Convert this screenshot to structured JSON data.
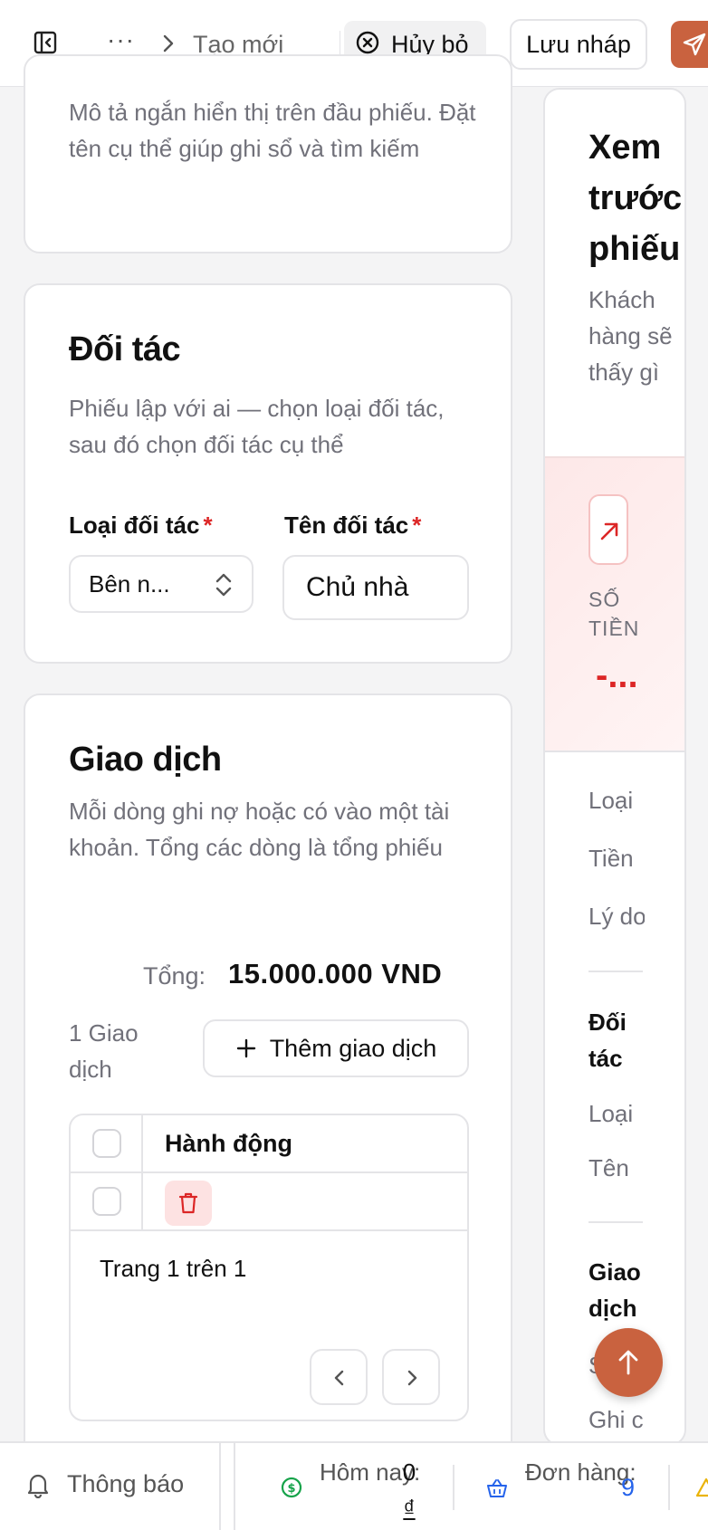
{
  "header": {
    "more_label": "···",
    "breadcrumb_current": "Tạo mới",
    "cancel_label": "Hủy bỏ",
    "save_draft_label": "Lưu nháp",
    "accent_color": "#c9623f"
  },
  "general": {
    "description": "Mô tả ngắn hiển thị trên đầu phiếu. Đặt tên cụ thể giúp ghi sổ và tìm kiếm"
  },
  "partner": {
    "title": "Đối tác",
    "description": "Phiếu lập với ai — chọn loại đối tác, sau đó chọn đối tác cụ thể",
    "type_label": "Loại đối tác",
    "type_value": "Bên n...",
    "name_label": "Tên đối tác",
    "name_value": "Chủ nhà",
    "required_mark": "*"
  },
  "transactions": {
    "title": "Giao dịch",
    "description": "Mỗi dòng ghi nợ hoặc có vào một tài khoản. Tổng các dòng là tổng phiếu",
    "total_label": "Tổng:",
    "total_value": "15.000.000 VND",
    "count_text": "1 Giao dịch",
    "add_button_label": "Thêm giao dịch",
    "table": {
      "columns": [
        "Hành động"
      ],
      "row_count": 1
    },
    "pagination_text": "Trang 1 trên 1"
  },
  "preview": {
    "title": "Xem trước phiếu",
    "subtitle": "Khách hàng sẽ thấy gì",
    "amount_label": "SỐ TIỀN",
    "amount_value": "-...",
    "rows": [
      "Loại",
      "Tiền",
      "Lý do"
    ],
    "partner_heading": "Đối tác",
    "partner_rows": [
      "Loại",
      "Tên"
    ],
    "transactions_heading": "Giao dịch",
    "transactions_rows": [
      "S",
      "Ghi c"
    ]
  },
  "statusbar": {
    "notifications_label": "Thông báo",
    "today_label": "Hôm nay:",
    "today_value_num": "0",
    "today_value_cur": "₫",
    "orders_label": "Đơn hàng:",
    "orders_value": "9"
  },
  "icons": {
    "sidebar": "sidebar-toggle-icon",
    "cancel": "x-circle-icon",
    "send": "send-icon",
    "add": "plus-icon",
    "delete": "trash-icon",
    "arrow": "arrow-up-right-icon",
    "fab": "arrow-up-icon",
    "bell": "bell-icon",
    "money": "dollar-circle-icon",
    "basket": "basket-icon",
    "warning": "warning-icon"
  }
}
